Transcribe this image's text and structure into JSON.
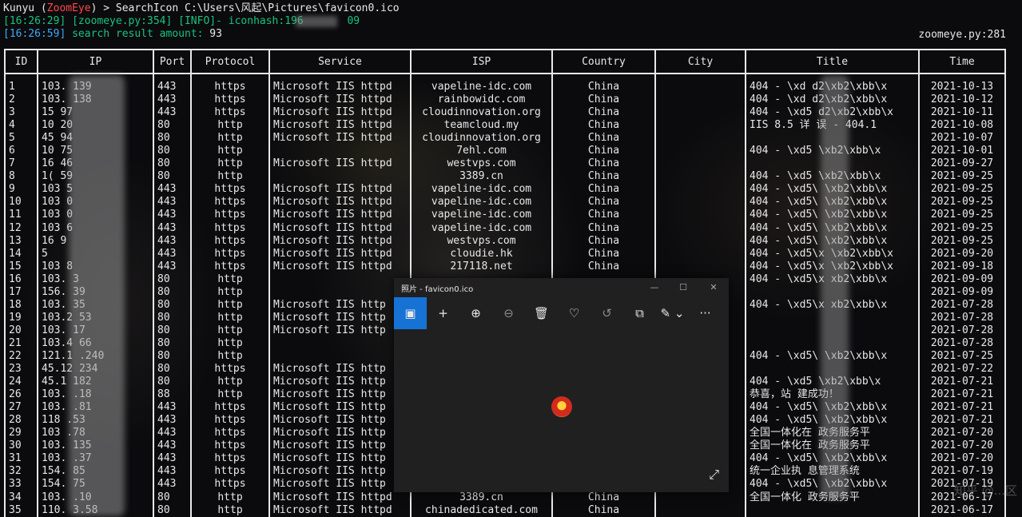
{
  "terminal": {
    "prompt_user": "Kunyu (",
    "prompt_brand": "ZoomEye",
    "prompt_rest": ") > SearchIcon C:\\Users\\风起\\Pictures\\favicon0.ico",
    "log1": "[16:26:29] [zoomeye.py:354] [INFO]- iconhash:196       09",
    "log2_time": "[16:26:59]",
    "log2_msg": " search result amount: ",
    "log2_amount": "93",
    "source": "zoomeye.py:281"
  },
  "table": {
    "headers": [
      "ID",
      "IP",
      "Port",
      "Protocol",
      "Service",
      "ISP",
      "Country",
      "City",
      "Title",
      "Time"
    ],
    "rows": [
      [
        "1",
        "103.   139",
        "443",
        "https",
        "Microsoft IIS httpd",
        "vapeline-idc.com",
        "China",
        "",
        "404 - \\xd   d2\\xb2\\xbb\\x",
        "2021-10-13"
      ],
      [
        "2",
        "103.   138",
        "443",
        "https",
        "Microsoft IIS httpd",
        "rainbowidc.com",
        "China",
        "",
        "404 - \\xd   d2\\xb2\\xbb\\x",
        "2021-10-12"
      ],
      [
        "3",
        "15     97",
        "443",
        "https",
        "Microsoft IIS httpd",
        "cloudinnovation.org",
        "China",
        "",
        "404 - \\xd5  d2\\xb2\\xbb\\x",
        "2021-10-11"
      ],
      [
        "4",
        "10     20",
        "80",
        "http",
        "Microsoft IIS httpd",
        "teamcloud.my",
        "China",
        "",
        "IIS 8.5 详   误 - 404.1",
        "2021-10-08"
      ],
      [
        "5",
        "45     94",
        "80",
        "http",
        "Microsoft IIS httpd",
        "cloudinnovation.org",
        "China",
        "",
        "",
        "2021-10-07"
      ],
      [
        "6",
        "10     75",
        "80",
        "http",
        "",
        "7ehl.com",
        "China",
        "",
        "404 - \\xd5     \\xb2\\xbb\\x",
        "2021-10-01"
      ],
      [
        "7",
        "16     46",
        "80",
        "http",
        "Microsoft IIS httpd",
        "westvps.com",
        "China",
        "",
        "",
        "2021-09-27"
      ],
      [
        "8",
        "1(     59",
        "80",
        "http",
        "",
        "3389.cn",
        "China",
        "",
        "404 - \\xd5     \\xb2\\xbb\\x",
        "2021-09-25"
      ],
      [
        "9",
        "103    5",
        "443",
        "https",
        "Microsoft IIS httpd",
        "vapeline-idc.com",
        "China",
        "",
        "404 - \\xd5\\    \\xb2\\xbb\\x",
        "2021-09-25"
      ],
      [
        "10",
        "103    0",
        "443",
        "https",
        "Microsoft IIS httpd",
        "vapeline-idc.com",
        "China",
        "",
        "404 - \\xd5\\    \\xb2\\xbb\\x",
        "2021-09-25"
      ],
      [
        "11",
        "103    0",
        "443",
        "https",
        "Microsoft IIS httpd",
        "vapeline-idc.com",
        "China",
        "",
        "404 - \\xd5\\    \\xb2\\xbb\\x",
        "2021-09-25"
      ],
      [
        "12",
        "103    6",
        "443",
        "https",
        "Microsoft IIS httpd",
        "vapeline-idc.com",
        "China",
        "",
        "404 - \\xd5\\    \\xb2\\xbb\\x",
        "2021-09-25"
      ],
      [
        "13",
        "16     9",
        "443",
        "https",
        "Microsoft IIS httpd",
        "westvps.com",
        "China",
        "",
        "404 - \\xd5\\    \\xb2\\xbb\\x",
        "2021-09-25"
      ],
      [
        "14",
        "5      ",
        "443",
        "https",
        "Microsoft IIS httpd",
        "cloudie.hk",
        "China",
        "",
        "404 - \\xd5\\x   \\xb2\\xbb\\x",
        "2021-09-20"
      ],
      [
        "15",
        "103    8",
        "443",
        "https",
        "Microsoft IIS httpd",
        "217118.net",
        "China",
        "",
        "404 - \\xd5\\x   \\xb2\\xbb\\x",
        "2021-09-18"
      ],
      [
        "16",
        "103.   3",
        "80",
        "http",
        "",
        "",
        "",
        "",
        "404 - \\xd5\\x   xb2\\xbb\\x",
        "2021-09-09"
      ],
      [
        "17",
        "156.   39",
        "80",
        "http",
        "",
        "",
        "",
        "",
        "",
        "2021-09-09"
      ],
      [
        "18",
        "103.   35",
        "80",
        "http",
        "Microsoft IIS http",
        "",
        "",
        "",
        "404 - \\xd5\\x   xb2\\xbb\\x",
        "2021-07-28"
      ],
      [
        "19",
        "103.2  53",
        "80",
        "http",
        "Microsoft IIS http",
        "",
        "",
        "",
        "",
        "2021-07-28"
      ],
      [
        "20",
        "103.   17",
        "80",
        "http",
        "Microsoft IIS http",
        "",
        "",
        "",
        "",
        "2021-07-28"
      ],
      [
        "21",
        "103.4  66",
        "80",
        "http",
        "",
        "",
        "",
        "",
        "",
        "2021-07-28"
      ],
      [
        "22",
        "121.1  .240",
        "80",
        "http",
        "",
        "",
        "",
        "",
        "404 - \\xd5\\    \\xb2\\xbb\\x",
        "2021-07-25"
      ],
      [
        "23",
        "45.12  234",
        "80",
        "https",
        "Microsoft IIS http",
        "",
        "",
        "",
        "",
        "2021-07-22"
      ],
      [
        "24",
        "45.1   182",
        "80",
        "http",
        "Microsoft IIS http",
        "",
        "",
        "",
        "404 - \\xd5   \\xb2\\xbb\\x",
        "2021-07-21"
      ],
      [
        "26",
        "103.   .18",
        "88",
        "http",
        "Microsoft IIS http",
        "",
        "",
        "",
        "恭喜，站   建成功！",
        "2021-07-21"
      ],
      [
        "27",
        "103.   .81",
        "443",
        "https",
        "Microsoft IIS http",
        "",
        "",
        "",
        "404 - \\xd5\\   \\xb2\\xbb\\x",
        "2021-07-21"
      ],
      [
        "28",
        "118    .53",
        "443",
        "https",
        "Microsoft IIS http",
        "",
        "",
        "",
        "404 - \\xd5\\   \\xb2\\xbb\\x",
        "2021-07-21"
      ],
      [
        "29",
        "103    .78",
        "443",
        "https",
        "Microsoft IIS http",
        "",
        "",
        "",
        "全国一体化在  政务服务平",
        "2021-07-20"
      ],
      [
        "30",
        "103.   135",
        "443",
        "https",
        "Microsoft IIS http",
        "",
        "",
        "",
        "全国一体化在  政务服务平",
        "2021-07-20"
      ],
      [
        "31",
        "103.   .37",
        "443",
        "https",
        "Microsoft IIS http",
        "",
        "",
        "",
        "404 - \\xd5\\   \\xb2\\xbb\\x",
        "2021-07-20"
      ],
      [
        "32",
        "154.   85",
        "443",
        "https",
        "Microsoft IIS http",
        "",
        "",
        "",
        "统一企业执   息管理系统",
        "2021-07-19"
      ],
      [
        "33",
        "154.   75",
        "443",
        "https",
        "Microsoft IIS http",
        "",
        "",
        "",
        "404 - \\xd5\\   \\xb2\\xbb\\x",
        "2021-07-19"
      ],
      [
        "34",
        "103.   .10",
        "80",
        "http",
        "Microsoft IIS httpd",
        "3389.cn",
        "China",
        "",
        "全国一体化   政务服务平",
        "2021-06-17"
      ],
      [
        "35",
        "110.   3.58",
        "80",
        "http",
        "Microsoft IIS httpd",
        "chinadedicated.com",
        "China",
        "",
        "",
        "2021-06-17"
      ]
    ]
  },
  "photos": {
    "title": "照片 - favicon0.ico",
    "controls": {
      "minimize": "—",
      "maximize": "☐",
      "close": "✕"
    },
    "tools": [
      {
        "icon": "image-icon",
        "glyph": "▣"
      },
      {
        "icon": "add-icon",
        "glyph": "+"
      },
      {
        "icon": "zoom-in-icon",
        "glyph": "⊕"
      },
      {
        "icon": "zoom-out-icon",
        "glyph": "⊖"
      },
      {
        "icon": "delete-icon",
        "glyph": "🗑"
      },
      {
        "icon": "favorite-icon",
        "glyph": "♡"
      },
      {
        "icon": "rotate-icon",
        "glyph": "↺"
      },
      {
        "icon": "crop-icon",
        "glyph": "⧉"
      },
      {
        "icon": "edit-icon",
        "glyph": "✎ ⌄"
      },
      {
        "icon": "more-icon",
        "glyph": "···"
      }
    ],
    "expand_glyph": "⤢"
  },
  "watermark": "知乎 @...区"
}
